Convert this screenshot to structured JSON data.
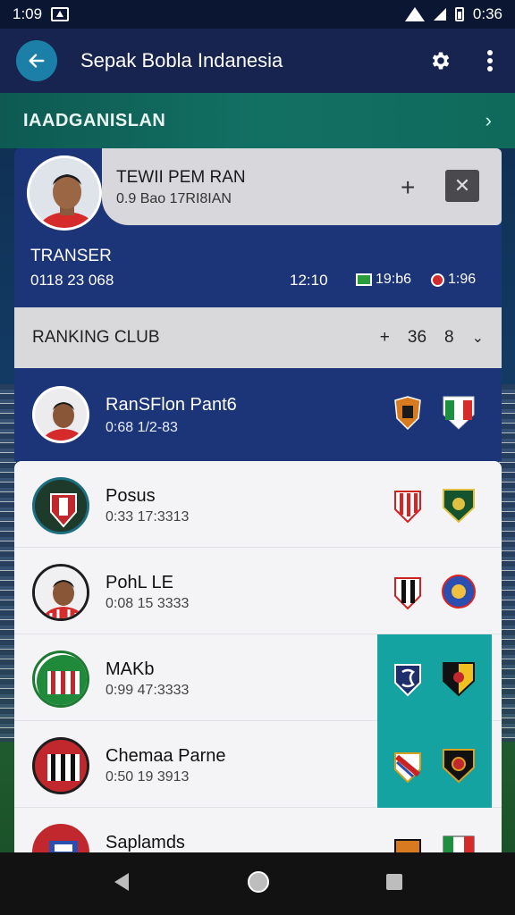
{
  "status": {
    "time": "1:09",
    "clock": "0:36"
  },
  "appbar": {
    "title": "Sepak Bobla Indanesia"
  },
  "section": {
    "label": "IAADGANISLAN"
  },
  "transfer": {
    "title": "TEWII PEM RAN",
    "subtitle": "0.9 Bao 17RI8IAN",
    "label": "TRANSER",
    "line": "0118 23 068",
    "time": "12:10",
    "count1": "19:b6",
    "count2": "1:96"
  },
  "ranking": {
    "label": "RANKING CLUB",
    "value1": "36",
    "value2": "8"
  },
  "highlight": {
    "name": "RanSFlon Pant6",
    "stats": "0:68 1/2-83"
  },
  "rows": [
    {
      "name": "Posus",
      "stats": "0:33 17:3313"
    },
    {
      "name": "PohL LE",
      "stats": "0:08 15 3333"
    },
    {
      "name": "MAKb",
      "stats": "0:99 47:3333"
    },
    {
      "name": "Chemaa Parne",
      "stats": "0:50 19 3913"
    },
    {
      "name": "Saplamds",
      "stats": ""
    }
  ],
  "colors": {
    "appbar": "#16244f",
    "accent": "#1c7fa8",
    "card": "#1c3478",
    "teal": "#14a3a0",
    "section": "#127063"
  }
}
